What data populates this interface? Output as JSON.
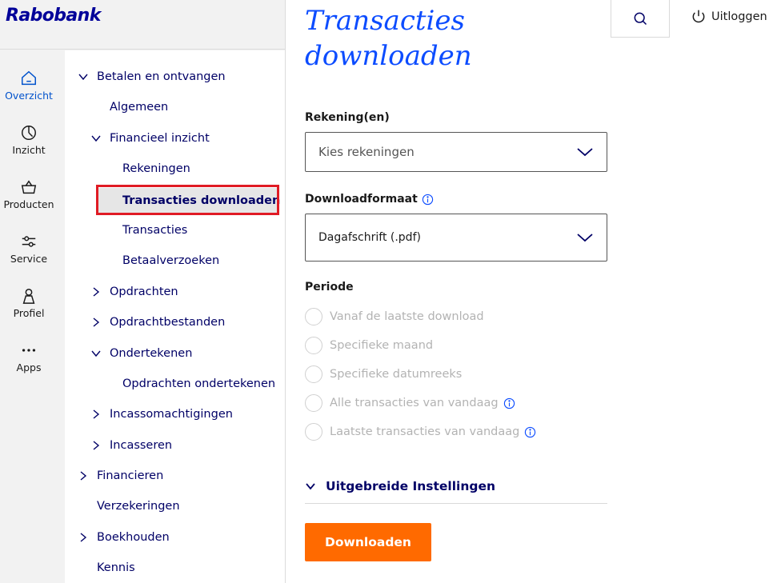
{
  "brand": {
    "logo": "Rabobank"
  },
  "iconbar": [
    {
      "icon": "home-icon",
      "label": "Overzicht",
      "active": true
    },
    {
      "icon": "pie-chart-icon",
      "label": "Inzicht"
    },
    {
      "icon": "basket-icon",
      "label": "Producten"
    },
    {
      "icon": "sliders-icon",
      "label": "Service"
    },
    {
      "icon": "person-icon",
      "label": "Profiel"
    },
    {
      "icon": "dots-icon",
      "label": "Apps"
    }
  ],
  "subnav": [
    {
      "label": "Betalen en ontvangen",
      "chevron": "down",
      "level": 0
    },
    {
      "label": "Algemeen",
      "chevron": "none",
      "level": 1
    },
    {
      "label": "Financieel inzicht",
      "chevron": "down",
      "level": 1
    },
    {
      "label": "Rekeningen",
      "chevron": "none",
      "level": 2
    },
    {
      "label": "Transacties downloaden",
      "chevron": "none",
      "level": 2,
      "selected": true
    },
    {
      "label": "Transacties",
      "chevron": "none",
      "level": 2
    },
    {
      "label": "Betaalverzoeken",
      "chevron": "none",
      "level": 2
    },
    {
      "label": "Opdrachten",
      "chevron": "right",
      "level": 1
    },
    {
      "label": "Opdrachtbestanden",
      "chevron": "right",
      "level": 1
    },
    {
      "label": "Ondertekenen",
      "chevron": "down",
      "level": 1
    },
    {
      "label": "Opdrachten ondertekenen",
      "chevron": "none",
      "level": 2
    },
    {
      "label": "Incassomachtigingen",
      "chevron": "right",
      "level": 1
    },
    {
      "label": "Incasseren",
      "chevron": "right",
      "level": 1
    },
    {
      "label": "Financieren",
      "chevron": "right",
      "level": 0
    },
    {
      "label": "Verzekeringen",
      "chevron": "none",
      "level": 0
    },
    {
      "label": "Boekhouden",
      "chevron": "right",
      "level": 0
    },
    {
      "label": "Kennis",
      "chevron": "none",
      "level": 0
    }
  ],
  "header": {
    "title_line1": "Transacties",
    "title_line2": "downloaden",
    "logout_label": "Uitloggen"
  },
  "form": {
    "accounts_label": "Rekening(en)",
    "accounts_placeholder": "Kies rekeningen",
    "format_label": "Downloadformaat",
    "format_value": "Dagafschrift (.pdf)",
    "period_label": "Periode",
    "period_options": [
      {
        "label": "Vanaf de laatste download",
        "info": false
      },
      {
        "label": "Specifieke maand",
        "info": false
      },
      {
        "label": "Specifieke datumreeks",
        "info": false
      },
      {
        "label": "Alle transacties van vandaag",
        "info": true
      },
      {
        "label": "Laatste transacties van vandaag",
        "info": true
      }
    ],
    "advanced_label": "Uitgebreide Instellingen",
    "download_label": "Downloaden"
  },
  "colors": {
    "accent_blue": "#0c4cff",
    "navy": "#000066",
    "download_orange": "#ff6a00",
    "highlight_red": "#e01b24"
  }
}
